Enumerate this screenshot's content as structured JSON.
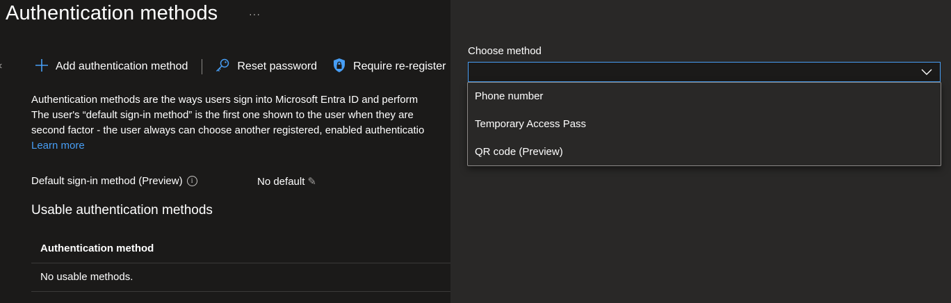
{
  "header": {
    "title": "Authentication methods",
    "more_icon": "ellipsis-icon",
    "more_glyph": "···"
  },
  "nav": {
    "collapse_glyph": "‹"
  },
  "toolbar": {
    "add_label": "Add authentication method",
    "reset_label": "Reset password",
    "reregister_label": "Require re-register"
  },
  "description": {
    "line1": "Authentication methods are the ways users sign into Microsoft Entra ID and perform",
    "line2": "The user's “default sign-in method” is the first one shown to the user when they are",
    "line3": "second factor - the user always can choose another registered, enabled authenticatio",
    "learn_more": "Learn more"
  },
  "default_sign_in": {
    "label": "Default sign-in method (Preview)",
    "info_glyph": "i",
    "value": "No default",
    "edit_glyph": "✎"
  },
  "usable": {
    "title": "Usable authentication methods",
    "column_header": "Authentication method",
    "empty_text": "No usable methods."
  },
  "panel": {
    "choose_label": "Choose method",
    "selected_value": "",
    "options": [
      "Phone number",
      "Temporary Access Pass",
      "QR code (Preview)"
    ]
  },
  "colors": {
    "background": "#1b1a19",
    "panel": "#292827",
    "accent": "#479ef5",
    "text": "#ffffff"
  }
}
